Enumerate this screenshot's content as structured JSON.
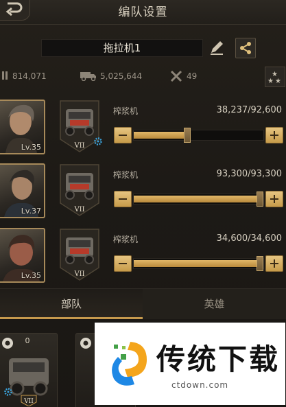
{
  "header": {
    "title": "编队设置"
  },
  "squad": {
    "name": "拖拉机1"
  },
  "stats": [
    {
      "icon": "ammo-icon",
      "value": "814,071"
    },
    {
      "icon": "truck-icon",
      "value": "5,025,644"
    },
    {
      "icon": "tools-icon",
      "value": "49"
    }
  ],
  "rows": [
    {
      "unit_name": "榨浆机",
      "hp": "38,237/92,600",
      "level": "Lv.35",
      "tier": "VII",
      "fill_fraction": 0.41
    },
    {
      "unit_name": "榨浆机",
      "hp": "93,300/93,300",
      "level": "Lv.37",
      "tier": "VII",
      "fill_fraction": 1.0
    },
    {
      "unit_name": "榨浆机",
      "hp": "34,600/34,600",
      "level": "Lv.35",
      "tier": "VII",
      "fill_fraction": 1.0
    }
  ],
  "tabs": {
    "troops": "部队",
    "heroes": "英雄"
  },
  "cards": [
    {
      "count": "0",
      "tier": "VII"
    },
    {
      "count": "",
      "tier": ""
    }
  ],
  "watermark": {
    "brand": "传统下载",
    "url": "ctdown.com"
  },
  "colors": {
    "accent": "#c79a4d",
    "fill": "#e1b768",
    "background": "#1b1814"
  }
}
